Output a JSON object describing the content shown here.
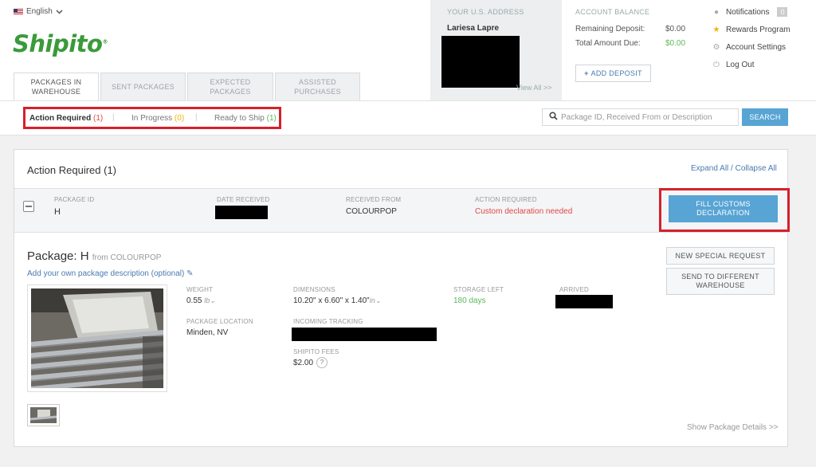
{
  "header": {
    "language": "English",
    "logo_text": "Shipito",
    "logo_mark": "®",
    "tabs": [
      {
        "label": "PACKAGES IN WAREHOUSE",
        "line1": "PACKAGES IN",
        "line2": "WAREHOUSE",
        "active": true
      },
      {
        "label": "SENT PACKAGES",
        "line1": "SENT PACKAGES",
        "line2": "",
        "active": false
      },
      {
        "label": "EXPECTED PACKAGES",
        "line1": "EXPECTED",
        "line2": "PACKAGES",
        "active": false
      },
      {
        "label": "ASSISTED PURCHASES",
        "line1": "ASSISTED",
        "line2": "PURCHASES",
        "active": false
      }
    ]
  },
  "address": {
    "label": "YOUR U.S. ADDRESS",
    "name": "Lariesa Lapre",
    "view_all": "View All >>"
  },
  "balance": {
    "label": "ACCOUNT BALANCE",
    "remaining_label": "Remaining Deposit:",
    "remaining_value": "$0.00",
    "due_label": "Total Amount Due:",
    "due_value": "$0.00",
    "add_deposit": "ADD DEPOSIT"
  },
  "user_menu": {
    "notifications": "Notifications",
    "notifications_count": "0",
    "rewards": "Rewards Program",
    "settings": "Account Settings",
    "logout": "Log Out"
  },
  "filters": {
    "action_required": "Action Required",
    "action_required_count": "(1)",
    "in_progress": "In Progress",
    "in_progress_count": "(0)",
    "ready_to_ship": "Ready to Ship",
    "ready_to_ship_count": "(1)",
    "separator": "|"
  },
  "search": {
    "placeholder": "Package ID, Received From or Description",
    "button": "SEARCH"
  },
  "panel": {
    "title": "Action Required (1)",
    "expand_collapse": "Expand All / Collapse All",
    "row": {
      "package_id_label": "PACKAGE ID",
      "package_id": "H",
      "date_received_label": "DATE RECEIVED",
      "received_from_label": "RECEIVED FROM",
      "received_from": "COLOURPOP",
      "action_required_label": "ACTION REQUIRED",
      "action_required": "Custom declaration needed",
      "action_button_line1": "FILL CUSTOMS",
      "action_button_line2": "DECLARATION"
    }
  },
  "package": {
    "title_prefix": "Package:",
    "id": "H",
    "from": "from COLOURPOP",
    "description_link": "Add your own package description (optional)",
    "weight_label": "WEIGHT",
    "weight": "0.55",
    "weight_unit": "lb",
    "dimensions_label": "DIMENSIONS",
    "dimensions": "10.20\" x 6.60\" x 1.40\"",
    "dimensions_unit": "in",
    "storage_label": "STORAGE LEFT",
    "storage": "180 days",
    "arrived_label": "ARRIVED",
    "location_label": "PACKAGE LOCATION",
    "location": "Minden, NV",
    "tracking_label": "INCOMING TRACKING",
    "fees_label": "SHIPITO FEES",
    "fees": "$2.00",
    "help_mark": "?",
    "special_request": "NEW SPECIAL REQUEST",
    "send_line1": "SEND TO DIFFERENT",
    "send_line2": "WAREHOUSE",
    "show_details": "Show Package Details >>"
  },
  "colors": {
    "brand_green": "#3a9a3a",
    "link_blue": "#4a7ab0",
    "button_blue": "#58a4d4",
    "highlight_red": "#d6202a",
    "alert_red": "#e04848",
    "success_green": "#5cb85c"
  }
}
